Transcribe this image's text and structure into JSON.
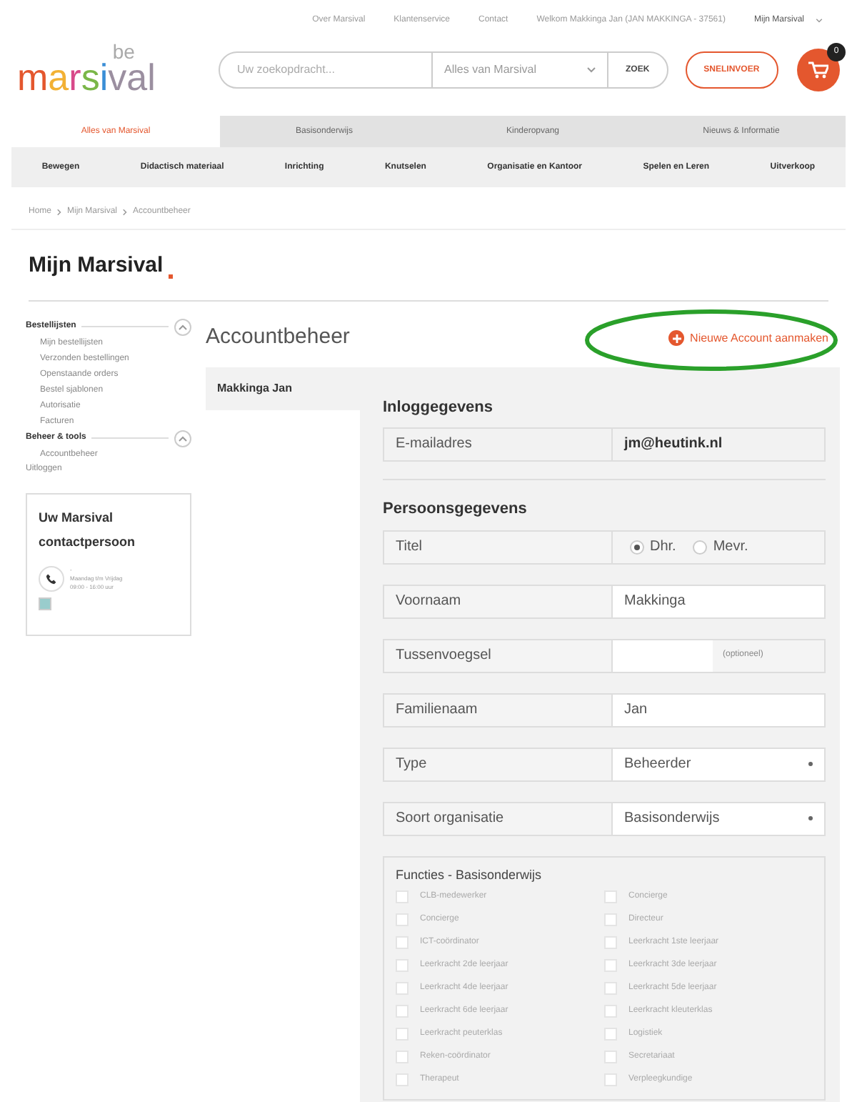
{
  "top_links": [
    "Over Marsival",
    "Klantenservice",
    "Contact"
  ],
  "welcome": "Welkom Makkinga Jan (JAN MAKKINGA - 37561)",
  "account_menu": "Mijn Marsival",
  "logo": {
    "letters": [
      "m",
      "a",
      "r",
      "s",
      "i",
      "v",
      "a",
      "l"
    ],
    "suffix": "be"
  },
  "search": {
    "placeholder": "Uw zoekopdracht...",
    "scope": "Alles van Marsival",
    "button": "ZOEK"
  },
  "quick_order": "SNELINVOER",
  "cart_count": "0",
  "tabs": [
    {
      "label": "Alles van Marsival",
      "selected": true
    },
    {
      "label": "Basisonderwijs",
      "selected": false
    },
    {
      "label": "Kinderopvang",
      "selected": false
    },
    {
      "label": "Nieuws & Informatie",
      "selected": false
    }
  ],
  "categories": [
    "Bewegen",
    "Didactisch materiaal",
    "Inrichting",
    "Knutselen",
    "Organisatie en Kantoor",
    "Spelen en Leren",
    "Uitverkoop"
  ],
  "breadcrumb": [
    "Home",
    "Mijn Marsival",
    "Accountbeheer"
  ],
  "page_title": "Mijn Marsival",
  "sidebar": [
    {
      "label": "Bestellijsten",
      "expanded": true,
      "children": [
        {
          "label": "Mijn bestellijsten"
        },
        {
          "label": "Verzonden bestellingen"
        },
        {
          "label": "Openstaande orders"
        },
        {
          "label": "Bestel sjablonen"
        },
        {
          "label": "Autorisatie"
        },
        {
          "label": "Facturen"
        }
      ]
    },
    {
      "label": "Beheer & tools",
      "expanded": true,
      "children": [
        {
          "label": "Accountbeheer"
        }
      ]
    },
    {
      "label": "Uitloggen"
    }
  ],
  "contact_card": {
    "title": "Uw Marsival contactpersoon",
    "phone": "-",
    "hours": "Maandag t/m Vrijdag",
    "time": "09:00 - 16:00 uur"
  },
  "section_title": "Accountbeheer",
  "new_account": "Nieuwe Account aanmaken",
  "accounts": [
    {
      "name": "Makkinga Jan",
      "selected": true
    }
  ],
  "login": {
    "title": "Inloggegevens",
    "email_label": "E-mailadres",
    "email": "jm@heutink.nl"
  },
  "personal": {
    "title": "Persoonsgegevens",
    "fields": [
      {
        "kind": "radio",
        "label": "Titel",
        "options": [
          {
            "label": "Dhr.",
            "selected": true
          },
          {
            "label": "Mevr.",
            "selected": false
          }
        ]
      },
      {
        "kind": "text",
        "label": "Voornaam",
        "value": "Makkinga"
      },
      {
        "kind": "text",
        "label": "Tussenvoegsel",
        "note": "(optioneel)"
      },
      {
        "kind": "text",
        "label": "Familienaam",
        "value": "Jan"
      },
      {
        "kind": "select",
        "label": "Type",
        "value": "Beheerder"
      },
      {
        "kind": "select",
        "label": "Soort organisatie",
        "value": "Basisonderwijs"
      }
    ]
  },
  "functions": {
    "title": "Functies - Basisonderwijs",
    "items": [
      {
        "label": "CLB-medewerker",
        "checked": false
      },
      {
        "label": "Concierge",
        "checked": false
      },
      {
        "label": "Concierge",
        "checked": false
      },
      {
        "label": "Directeur",
        "checked": false
      },
      {
        "label": "ICT-coördinator",
        "checked": false
      },
      {
        "label": "Leerkracht 1ste leerjaar",
        "checked": false
      },
      {
        "label": "Leerkracht 2de leerjaar",
        "checked": false
      },
      {
        "label": "Leerkracht 3de leerjaar",
        "checked": false
      },
      {
        "label": "Leerkracht 4de leerjaar",
        "checked": false
      },
      {
        "label": "Leerkracht 5de leerjaar",
        "checked": false
      },
      {
        "label": "Leerkracht 6de leerjaar",
        "checked": false
      },
      {
        "label": "Leerkracht kleuterklas",
        "checked": false
      },
      {
        "label": "Leerkracht peuterklas",
        "checked": false
      },
      {
        "label": "Logistiek",
        "checked": false
      },
      {
        "label": "Reken-coördinator",
        "checked": false
      },
      {
        "label": "Secretariaat",
        "checked": false
      },
      {
        "label": "Therapeut",
        "checked": false
      },
      {
        "label": "Verpleegkundige",
        "checked": false
      }
    ]
  }
}
